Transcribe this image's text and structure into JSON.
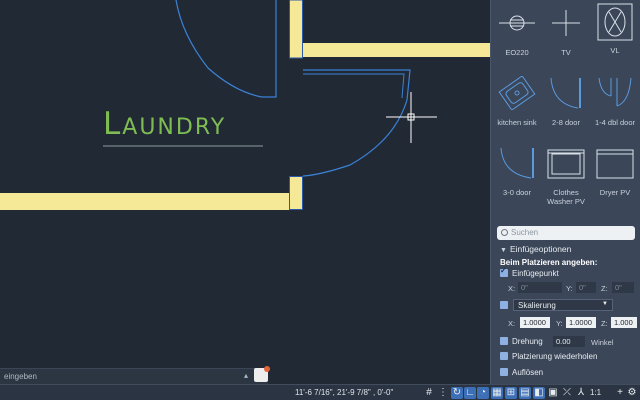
{
  "canvas": {
    "room_label": "Laundry",
    "command_line_placeholder": "eingeben",
    "colors": {
      "wall_fill": "#f5e896",
      "text": "#7fbd54",
      "door": "#3b82d6",
      "background": "#212935"
    }
  },
  "palette": {
    "tools": [
      {
        "label": "EO220",
        "icon": "outlet-symbol-icon"
      },
      {
        "label": "TV",
        "icon": "tv-symbol-icon"
      },
      {
        "label": "VL",
        "icon": "vl-symbol-icon"
      },
      {
        "label": "kitchen sink",
        "icon": "kitchen-sink-icon"
      },
      {
        "label": "2-8 door",
        "icon": "door-2-8-icon"
      },
      {
        "label": "1-4 dbl door",
        "icon": "double-door-icon"
      },
      {
        "label": "3-0 door",
        "icon": "door-3-0-icon"
      },
      {
        "label": "Clothes Washer PV",
        "icon": "washer-icon"
      },
      {
        "label": "Dryer PV",
        "icon": "dryer-icon"
      }
    ],
    "search_placeholder": "Suchen",
    "options": {
      "section_title": "Einfügeoptionen",
      "subtitle": "Beim Platzieren angeben:",
      "insertion_point": "Einfügepunkt",
      "ip_x_label": "X:",
      "ip_x": "0\"",
      "ip_y_label": "Y:",
      "ip_y": "0\"",
      "ip_z_label": "Z:",
      "ip_z": "0\"",
      "scaling": "Skalierung",
      "scale_x_label": "X:",
      "scale_x": "1.0000",
      "scale_y_label": "Y:",
      "scale_y": "1.0000",
      "scale_z_label": "Z:",
      "scale_z": "1.000",
      "rotation": "Drehung",
      "rotation_value": "0.00",
      "rotation_unit": "Winkel",
      "repeat_placement": "Platzierung wiederholen",
      "explode": "Auflösen"
    }
  },
  "status": {
    "coords": "11'-6 7/16\", 21'-9 7/8\" , 0'-0\"",
    "scale": "1:1"
  }
}
